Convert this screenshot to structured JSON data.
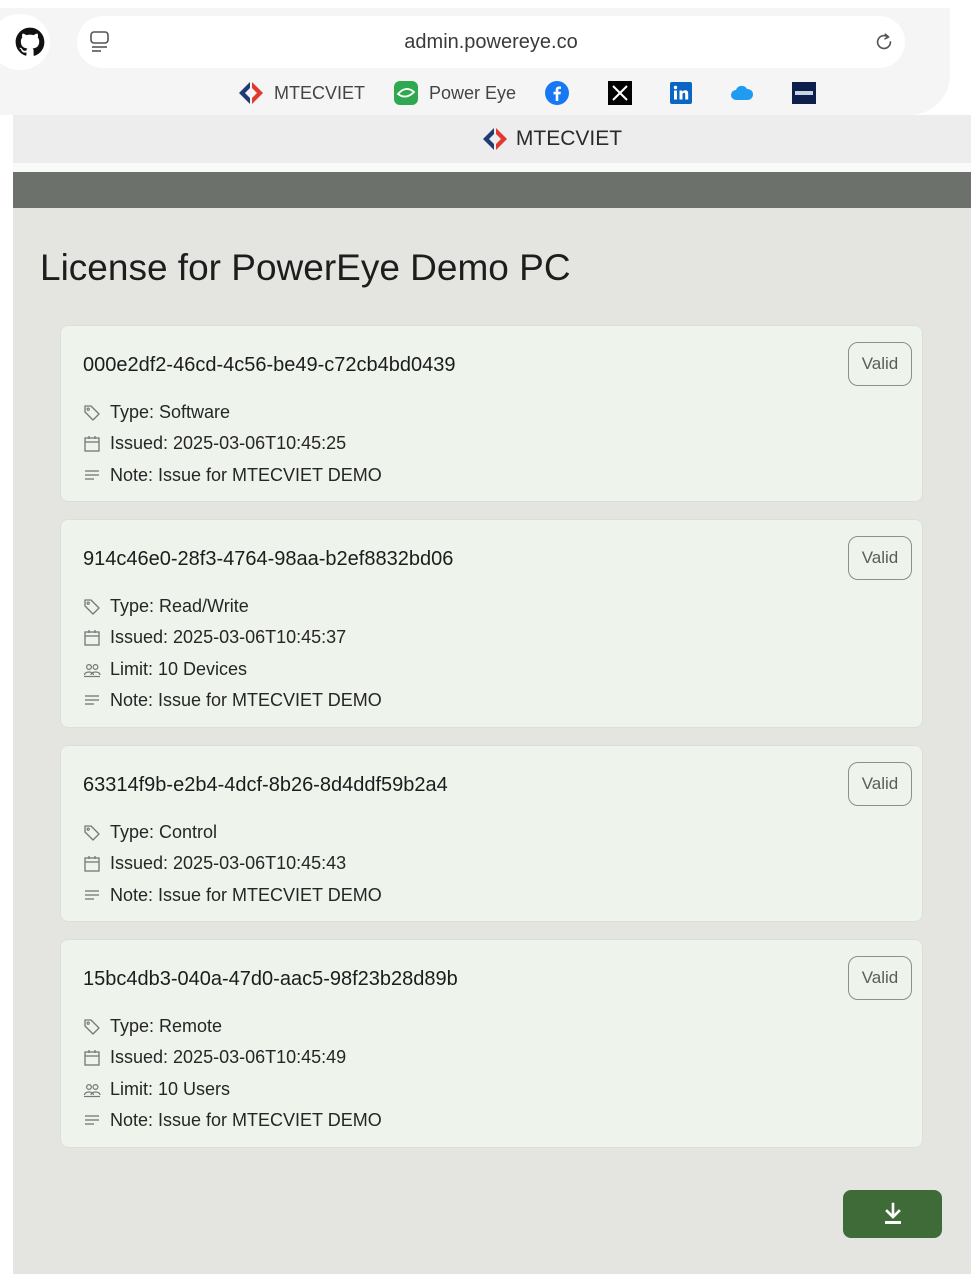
{
  "browser": {
    "url": "admin.powereye.co",
    "bookmarks": [
      {
        "label": "MTECVIET",
        "icon": "mtecviet-logo-icon"
      },
      {
        "label": "Power Eye",
        "icon": "power-eye-logo-icon"
      },
      {
        "label": "",
        "icon": "facebook-icon"
      },
      {
        "label": "",
        "icon": "x-icon"
      },
      {
        "label": "",
        "icon": "linkedin-icon"
      },
      {
        "label": "",
        "icon": "cloud-icon"
      },
      {
        "label": "",
        "icon": "crbc-icon"
      }
    ]
  },
  "app_bar": {
    "brand": "MTECVIET"
  },
  "page": {
    "title": "License for PowerEye Demo PC"
  },
  "licenses": [
    {
      "id": "000e2df2-46cd-4c56-be49-c72cb4bd0439",
      "status": "Valid",
      "type": "Type: Software",
      "issued": "Issued: 2025-03-06T10:45:25",
      "note": "Note: Issue for MTECVIET DEMO"
    },
    {
      "id": "914c46e0-28f3-4764-98aa-b2ef8832bd06",
      "status": "Valid",
      "type": "Type: Read/Write",
      "issued": "Issued: 2025-03-06T10:45:37",
      "limit": "Limit: 10 Devices",
      "note": "Note: Issue for MTECVIET DEMO"
    },
    {
      "id": "63314f9b-e2b4-4dcf-8b26-8d4ddf59b2a4",
      "status": "Valid",
      "type": "Type: Control",
      "issued": "Issued: 2025-03-06T10:45:43",
      "note": "Note: Issue for MTECVIET DEMO"
    },
    {
      "id": "15bc4db3-040a-47d0-aac5-98f23b28d89b",
      "status": "Valid",
      "type": "Type: Remote",
      "issued": "Issued: 2025-03-06T10:45:49",
      "limit": "Limit: 10 Users",
      "note": "Note: Issue for MTECVIET DEMO"
    }
  ],
  "fab": {
    "icon": "download-icon"
  },
  "colors": {
    "accent": "#3f6b38",
    "background": "#e4e5e0",
    "card": "#eef3eb",
    "band": "#6c716c"
  }
}
